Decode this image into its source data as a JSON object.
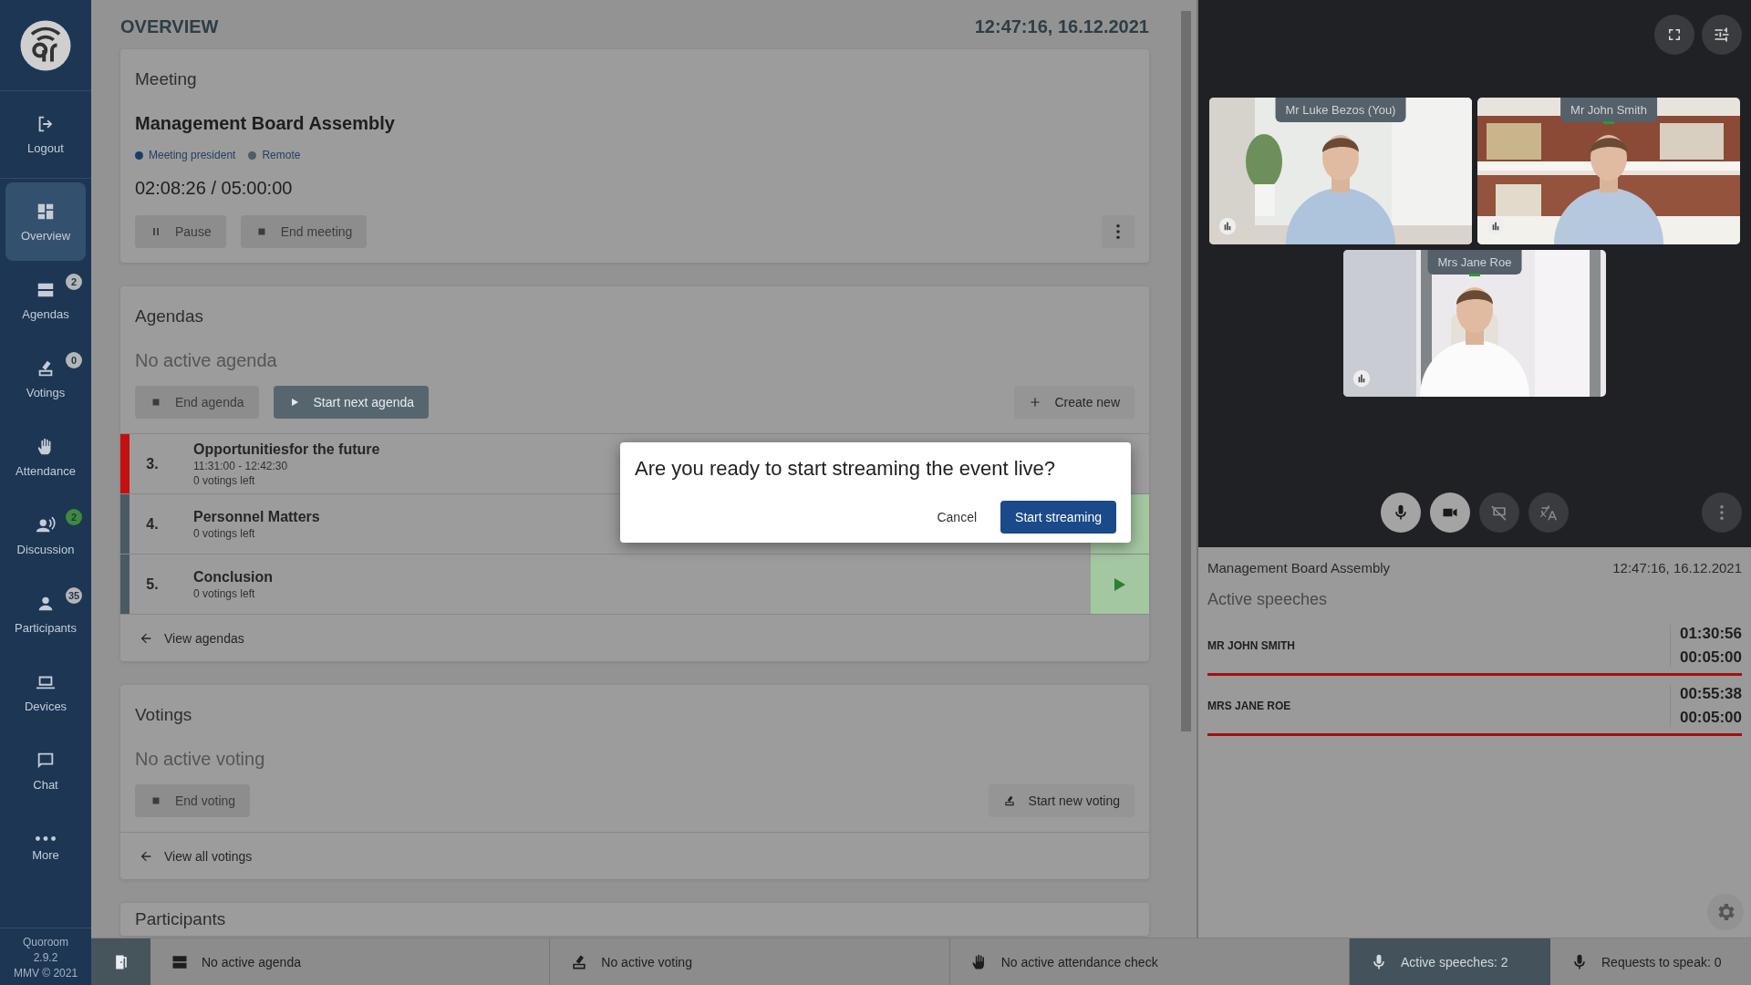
{
  "sidebar": {
    "items": [
      {
        "label": "Logout",
        "selected": false
      },
      {
        "label": "Overview",
        "selected": true
      },
      {
        "label": "Agendas",
        "selected": false,
        "badge": "2",
        "color": "#b5b5b5"
      },
      {
        "label": "Votings",
        "selected": false,
        "badge": "0",
        "color": "#b5b5b5"
      },
      {
        "label": "Attendance",
        "selected": false
      },
      {
        "label": "Discussion",
        "selected": false,
        "badge": "2",
        "color": "#3d8a3d"
      },
      {
        "label": "Participants",
        "selected": false,
        "badge": "35",
        "color": "#b5b5b5"
      },
      {
        "label": "Devices",
        "selected": false
      },
      {
        "label": "Chat",
        "selected": false
      },
      {
        "label": "More",
        "selected": false
      }
    ],
    "footer": [
      "Quoroom",
      "2.9.2",
      "MMV © 2021"
    ]
  },
  "header": {
    "title": "OVERVIEW",
    "datetime": "12:47:16, 16.12.2021"
  },
  "meeting": {
    "heading": "Meeting",
    "name": "Management Board Assembly",
    "roles": [
      {
        "label": "Meeting president",
        "color": "#1d3d63"
      },
      {
        "label": "Remote",
        "color": "#4f5d66"
      }
    ],
    "time": "02:08:26 / 05:00:00",
    "buttons": [
      {
        "label": "Pause",
        "kind": "pause",
        "disabled": true,
        "primary": false
      },
      {
        "label": "End meeting",
        "kind": "stop",
        "disabled": true,
        "primary": false
      }
    ]
  },
  "agendas": {
    "heading": "Agendas",
    "status": "No active agenda",
    "buttons": [
      {
        "label": "End agenda",
        "kind": "stop",
        "disabled": true,
        "primary": false
      },
      {
        "label": "Start next agenda",
        "kind": "play",
        "disabled": false,
        "primary": true
      }
    ],
    "action": {
      "label": "Create new",
      "kind": "plus",
      "disabled": false,
      "primary": false
    },
    "rows": [
      {
        "number": "3.",
        "title": "Opportunitiesfor the future",
        "time": "11:31:00 - 12:42:30",
        "votings": "0 votings left",
        "color": "#c41010",
        "kind": "plain"
      },
      {
        "number": "4.",
        "title": "Personnel Matters",
        "votings": "0 votings left",
        "color": "#4a5a62",
        "kind": "startable"
      },
      {
        "number": "5.",
        "title": "Conclusion",
        "votings": "0 votings left",
        "color": "#4a5a62",
        "kind": "startable",
        "play": true
      }
    ],
    "link": "View agendas"
  },
  "votings": {
    "heading": "Votings",
    "status": "No active voting",
    "buttons": [
      {
        "label": "End voting",
        "kind": "stop",
        "disabled": true,
        "primary": false
      }
    ],
    "action": {
      "label": "Start new voting",
      "kind": "ballot",
      "disabled": false,
      "primary": false
    },
    "link": "View all votings"
  },
  "participants": {
    "heading": "Participants"
  },
  "video": {
    "tiles": [
      {
        "name": "Mr Luke Bezos (You)",
        "speaking": false
      },
      {
        "name": "Mr John Smith",
        "speaking": true
      },
      {
        "name": "Mrs Jane Roe",
        "speaking": true
      }
    ],
    "controls": [
      {
        "on": true
      },
      {
        "on": true
      },
      {
        "on": false
      },
      {
        "on": false
      }
    ]
  },
  "info": {
    "meeting": "Management Board Assembly",
    "datetime": "12:47:16, 16.12.2021",
    "heading": "Active speeches",
    "speeches": [
      {
        "name": "MR JOHN SMITH",
        "elapsed": "01:30:56",
        "limit": "00:05:00"
      },
      {
        "name": "MRS JANE ROE",
        "elapsed": "00:55:38",
        "limit": "00:05:00"
      }
    ]
  },
  "status_bar": {
    "items": [
      {
        "label": "No active agenda",
        "selected": false
      },
      {
        "label": "No active voting",
        "selected": false
      },
      {
        "label": "No active attendance check",
        "selected": false
      },
      {
        "label": "Active speeches: 2",
        "selected": true
      },
      {
        "label": "Requests to speak: 0",
        "selected": false
      }
    ]
  },
  "dialog": {
    "question": "Are you ready to start streaming the event live?",
    "buttons": [
      {
        "label": "Cancel",
        "primary": false
      },
      {
        "label": "Start streaming",
        "primary": true
      }
    ]
  }
}
